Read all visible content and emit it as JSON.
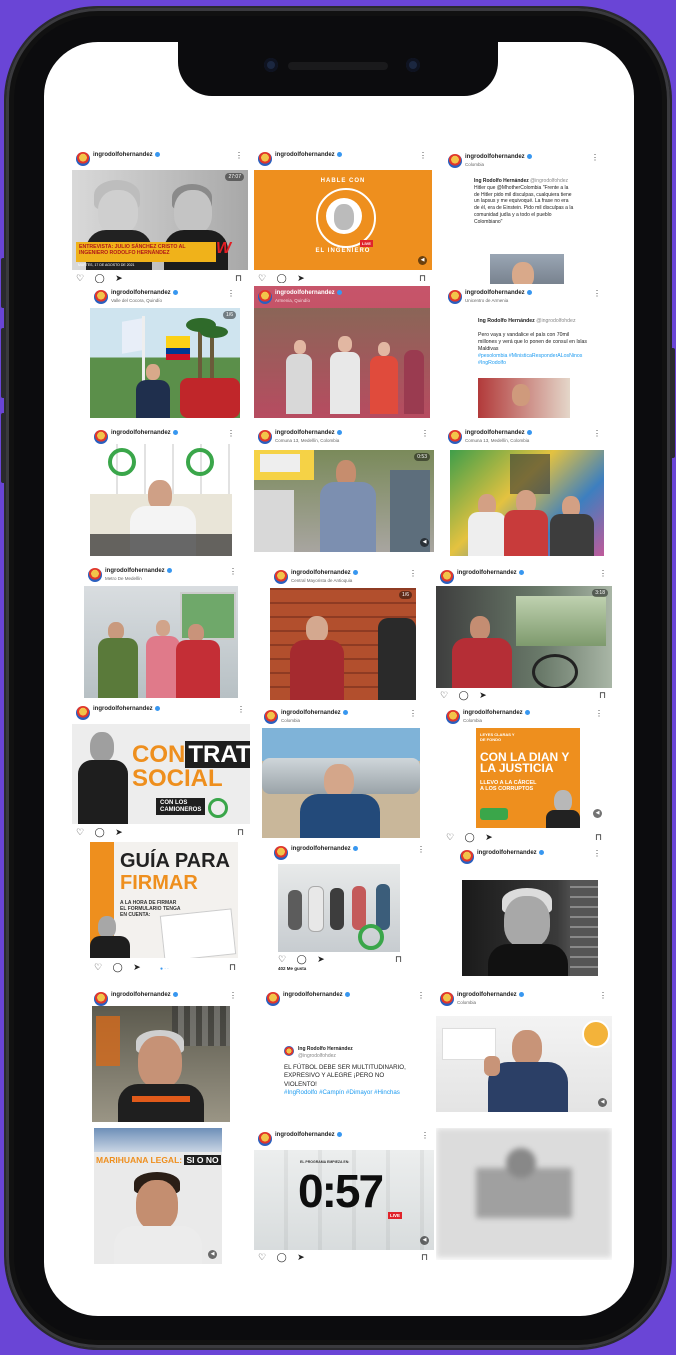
{
  "account": "ingrodolfohernandez",
  "posts": {
    "p1": {
      "loc": "",
      "badge": "27:07",
      "banner_line1": "ENTREVISTA: JULIO SÁNCHEZ CRISTO AL",
      "banner_line2": "INGENIERO RODOLFO HERNÁNDEZ",
      "banner_sub": "MARTES, 17 DE AGOSTO DE 2021"
    },
    "p2": {
      "loc": "",
      "ring_top": "HABLE CON",
      "ring_bottom": "EL INGENIERO",
      "live": "LIVE"
    },
    "p3": {
      "loc": "Colombia",
      "tw_name": "Ing Rodolfo Hernández",
      "tw_handle": "@ingrodolfohdez",
      "tw_text": "Hitler que @MhotherColombia \"Frente a la de Hitler pido mil disculpas, cualquiera tiene un lapsus y me equivoqué. La frase no era de él, era de Einstein. Pido mil disculpas a la comunidad judía y a todo el pueblo Colombiano\""
    },
    "p4": {
      "loc": "Valle del Cocora, Quindío",
      "badge": "1/6"
    },
    "p5": {
      "loc": "Armenia, Quindío"
    },
    "p6": {
      "loc": "Unicentro de Armenia",
      "tw_name": "Ing Rodolfo Hernández",
      "tw_handle": "@ingrodolfohdez",
      "tw_text": "Pero vaya y vandalice el país con 70mil millones y verá que lo ponen de consul en Islas Maldivas",
      "tw_tags": "#pesolombia #MinisticaResponderALosNinos #IngRodolfo"
    },
    "p7": {
      "loc": ""
    },
    "p8": {
      "loc": "Comuna 13, Medellín, Colombia",
      "badge": "0:53"
    },
    "p9": {
      "loc": "Comuna 13, Medellín, Colombia"
    },
    "p10": {
      "loc": "Metro De Medellín"
    },
    "p11": {
      "loc": "Central Mayorista de Antioquia",
      "badge": "1/6"
    },
    "p12": {
      "loc": "",
      "badge": "3:18"
    },
    "p13": {
      "loc": "",
      "t1": "CON",
      "t2": "TRATO",
      "t3": "SOCIAL",
      "t4": "CON LOS",
      "t5": "CAMIONEROS"
    },
    "p14": {
      "loc": "Colombia"
    },
    "p15": {
      "loc": "Colombia",
      "small": "LEYES CLARAS Y DE FONDO",
      "t1": "CON LA DIAN Y",
      "t2": "LA JUSTICIA",
      "t3": "LLEVO A LA CÁRCEL",
      "t4": "A LOS CORRUPTOS"
    },
    "p16": {
      "t1": "GUÍA PARA",
      "t2": "FIRMAR",
      "t3": "A LA HORA DE FIRMAR",
      "t4": "EL FORMULARIO TENGA",
      "t5": "EN CUENTA:"
    },
    "p17": {
      "loc": "",
      "likes": "402 Me gusta"
    },
    "p18": {
      "loc": ""
    },
    "p19": {
      "loc": ""
    },
    "p20": {
      "loc": "",
      "tw_name": "Ing Rodolfo Hernández",
      "tw_handle": "@ingrodolfohdez",
      "tw_text": "EL FÚTBOL DEBE SER MULTITUDINARIO, EXPRESIVO Y ALEGRE ¡PERO NO VIOLENTO!",
      "tw_tags": "#IngRodolfo #Campín #Dimayor #Hinchas"
    },
    "p21": {
      "loc": "Colombia"
    },
    "p22": {
      "t1": "MARIHUANA LEGAL:",
      "t2": "SI O NO"
    },
    "p23": {
      "loc": "",
      "top": "EL PROGRAMA EMPIEZA EN:",
      "timer": "0:57",
      "live": "LIVE"
    }
  },
  "colors": {
    "accent_orange": "#ee8f1e",
    "liga_green": "#3aa64a",
    "verified": "#3897f0",
    "phone_bg": "#6a45d6"
  }
}
